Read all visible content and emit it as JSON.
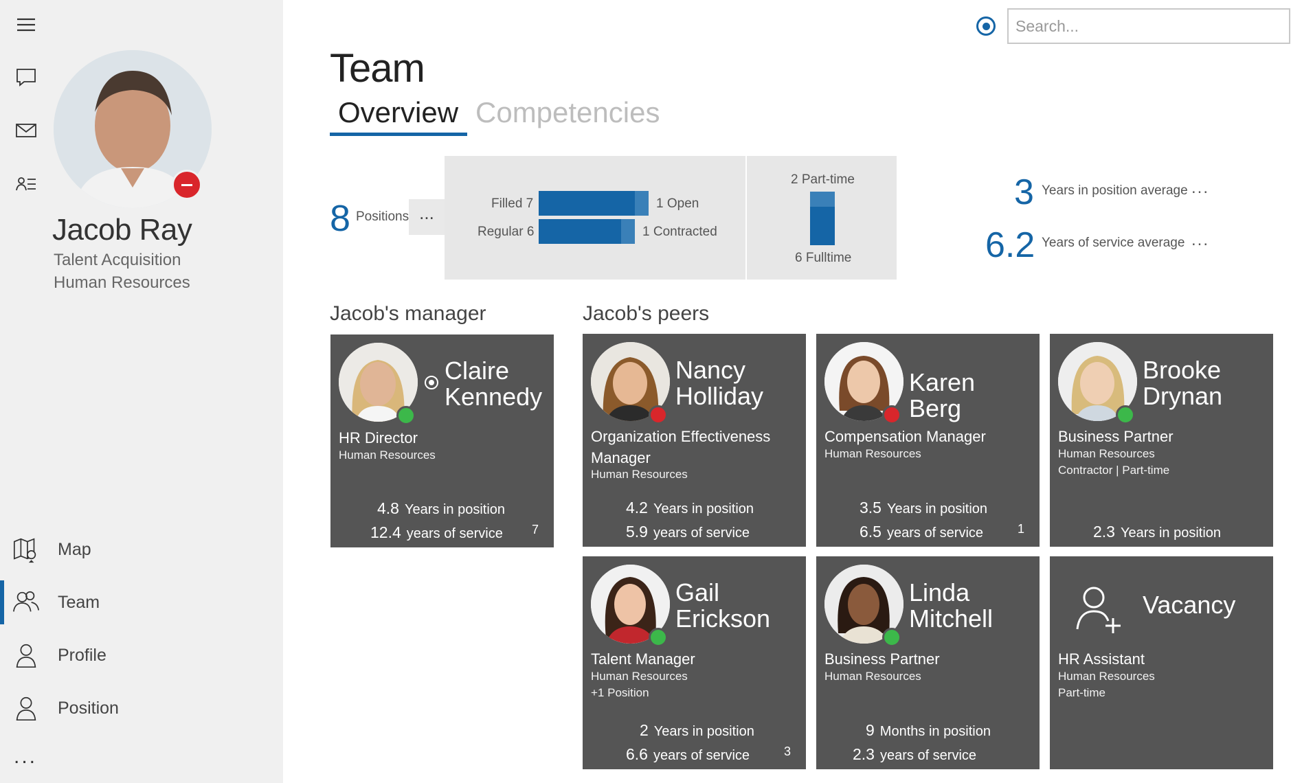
{
  "profile": {
    "name": "Jacob Ray",
    "role": "Talent Acquisition",
    "department": "Human Resources"
  },
  "nav": {
    "items": [
      {
        "label": "Map",
        "icon": "map-icon"
      },
      {
        "label": "Team",
        "icon": "team-icon"
      },
      {
        "label": "Profile",
        "icon": "person-icon"
      },
      {
        "label": "Position",
        "icon": "person-icon"
      }
    ],
    "more": "..."
  },
  "header": {
    "title": "Team",
    "tabs": [
      "Overview",
      "Competencies"
    ],
    "search_placeholder": "Search..."
  },
  "stats": {
    "positions_count": "8",
    "positions_label": "Positions",
    "more": "...",
    "filled": "Filled 7",
    "open": "1 Open",
    "regular": "Regular 6",
    "contracted": "1 Contracted",
    "part_time": "2 Part-time",
    "full_time": "6 Fulltime",
    "bars": {
      "filled": 7,
      "open": 1,
      "regular": 6,
      "contracted": 1,
      "part_time": 2,
      "full_time": 6
    },
    "avg_position": {
      "value": "3",
      "label": "Years in position average"
    },
    "avg_service": {
      "value": "6.2",
      "label": "Years of service  average"
    }
  },
  "sections": {
    "manager": "Jacob's manager",
    "peers": "Jacob's peers"
  },
  "manager": {
    "name": "Claire Kennedy",
    "title": "HR Director",
    "department": "Human Resources",
    "years_in_position": "4.8",
    "years_in_position_label": "Years in position",
    "years_of_service": "12.4",
    "years_of_service_label": "years of service",
    "count": "7"
  },
  "peers": [
    {
      "name": "Nancy Holliday",
      "title": "Organization Effectiveness Manager",
      "department": "Human Resources",
      "stat1": "4.2",
      "stat1_label": "Years in position",
      "stat2": "5.9",
      "stat2_label": "years of service",
      "count": ""
    },
    {
      "name": "Karen Berg",
      "title": "Compensation Manager",
      "department": "Human Resources",
      "stat1": "3.5",
      "stat1_label": "Years in position",
      "stat2": "6.5",
      "stat2_label": "years of service",
      "count": "1"
    },
    {
      "name": "Brooke Drynan",
      "title": "Business Partner",
      "department": "Human Resources",
      "extra": "Contractor | Part-time",
      "stat1": "2.3",
      "stat1_label": "Years in position"
    },
    {
      "name": "Gail Erickson",
      "title": "Talent Manager",
      "department": "Human Resources",
      "extra": "+1 Position",
      "stat1": "2",
      "stat1_label": "Years in position",
      "stat2": "6.6",
      "stat2_label": "years of service",
      "count": "3"
    },
    {
      "name": "Linda Mitchell",
      "title": "Business Partner",
      "department": "Human Resources",
      "stat1": "9",
      "stat1_label": "Months in position",
      "stat2": "2.3",
      "stat2_label": "years of service"
    },
    {
      "name": "Vacancy",
      "title": "HR Assistant",
      "department": "Human Resources",
      "extra": "Part-time"
    }
  ],
  "colors": {
    "accent": "#1565a6",
    "card_bg": "#555555",
    "status_busy": "#d9262b",
    "status_available": "#3cb84a"
  }
}
